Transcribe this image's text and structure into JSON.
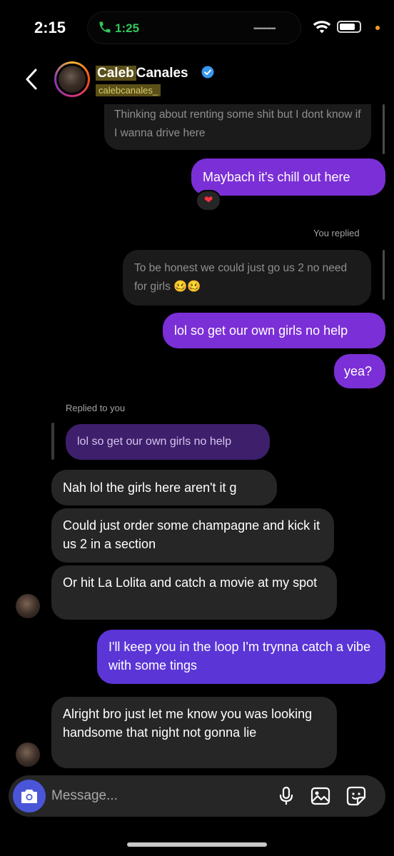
{
  "status_bar": {
    "time": "2:15",
    "call_time": "1:25",
    "battery_level": 0.8
  },
  "header": {
    "name_first": "Caleb",
    "name_last": "Canales",
    "handle": "calebcanales_",
    "verified": true
  },
  "messages": {
    "m1": "Thinking about renting some shit but I dont know if I wanna drive here",
    "m2": "Maybach it's chill out here",
    "m2_reaction": "❤",
    "you_replied": "You replied",
    "m3": "To be honest we could just go us 2 no need for girls 🥴🥴",
    "m4": "lol so get our own girls no help",
    "m5": "yea?",
    "replied_to_you": "Replied to you",
    "m6_quote": "lol so get our own girls no help",
    "m7": "Nah lol the girls here aren't it g",
    "m8": "Could just order some champagne and kick it us 2 in a section",
    "m9": "Or hit La Lolita and catch a movie at my spot",
    "m10": "I'll keep you in the loop I'm trynna catch a vibe with some tings",
    "m11": "Alright bro just let me know you was looking handsome that night not gonna lie"
  },
  "composer": {
    "placeholder": "Message..."
  },
  "colors": {
    "outgoing_bubble": "#7b2fd6",
    "incoming_bubble": "#262626",
    "camera_button": "#4b55d8",
    "verified_badge": "#3897f0"
  },
  "icons": [
    "phone-icon",
    "wifi-icon",
    "battery-icon",
    "back-chevron-icon",
    "verified-badge-icon",
    "camera-icon",
    "microphone-icon",
    "gallery-icon",
    "sticker-icon"
  ]
}
